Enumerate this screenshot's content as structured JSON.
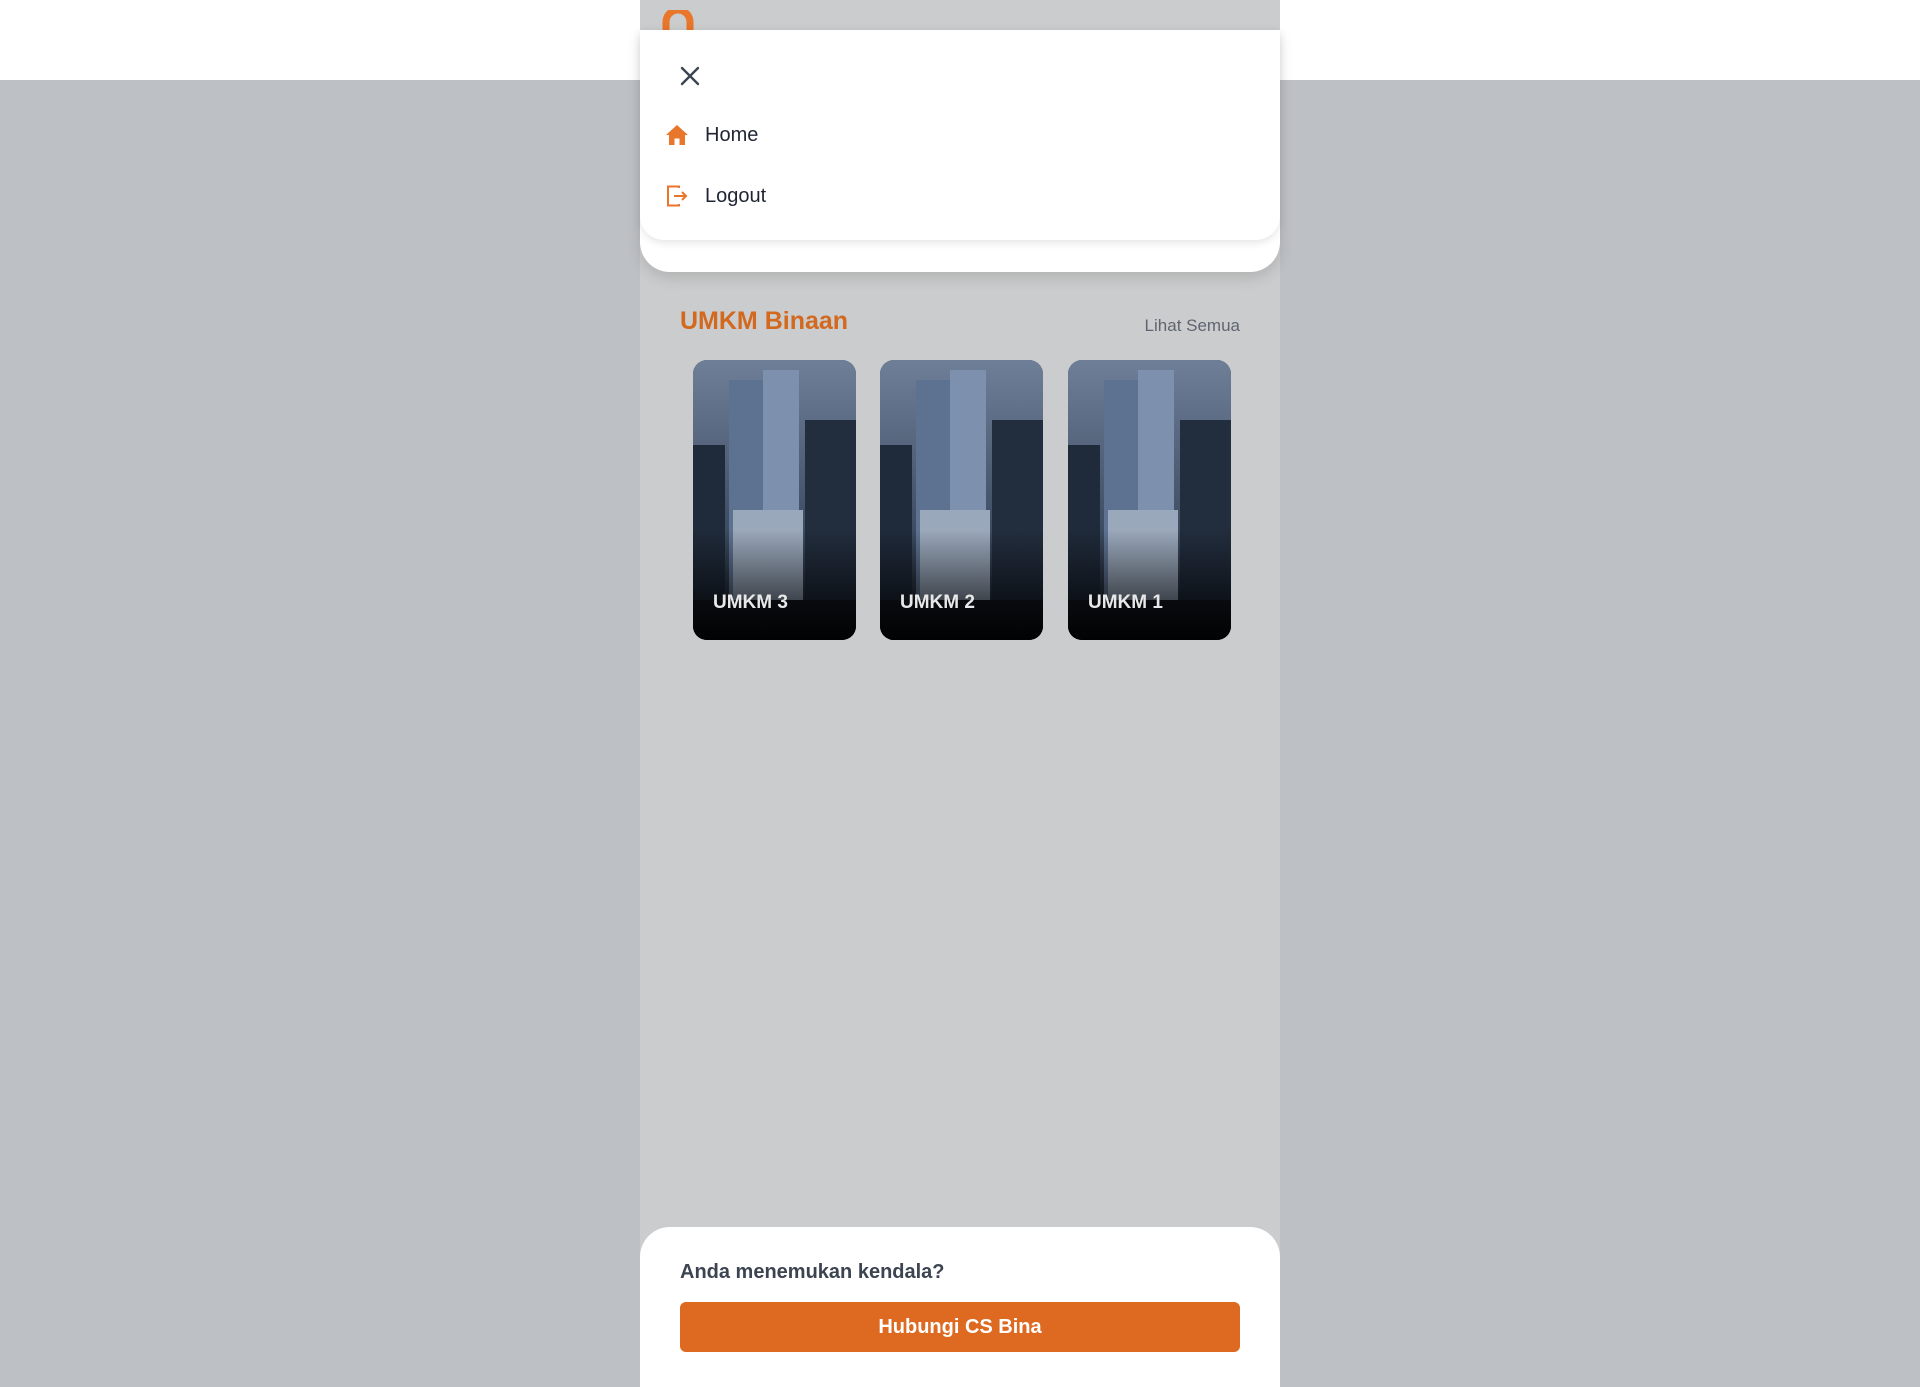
{
  "menu": {
    "items": [
      {
        "label": "Home",
        "icon": "home-icon"
      },
      {
        "label": "Logout",
        "icon": "logout-icon"
      }
    ]
  },
  "umkm_section": {
    "title": "UMKM Binaan",
    "see_all": "Lihat Semua",
    "cards": [
      {
        "name": "UMKM 3"
      },
      {
        "name": "UMKM 2"
      },
      {
        "name": "UMKM 1"
      }
    ]
  },
  "footer": {
    "question": "Anda menemukan kendala?",
    "button_label": "Hubungi CS Bina"
  },
  "colors": {
    "accent": "#de6a22",
    "title": "#d2691f"
  }
}
